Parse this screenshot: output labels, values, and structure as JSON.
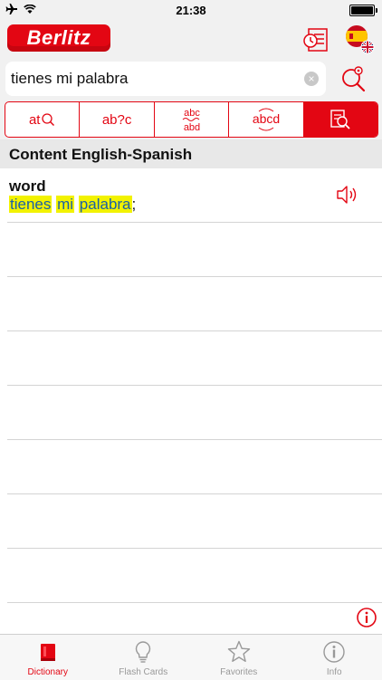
{
  "status": {
    "time": "21:38"
  },
  "header": {
    "logo_text": "Berlitz"
  },
  "search": {
    "value": "tienes mi palabra"
  },
  "modes": [
    {
      "label": "at",
      "icon": "search-word-icon"
    },
    {
      "label": "ab?c",
      "icon": "wildcard-icon"
    },
    {
      "label": "abc/abd",
      "icon": "fuzzy-icon"
    },
    {
      "label": "abcd",
      "icon": "anagram-icon"
    },
    {
      "label": "",
      "icon": "content-search-icon",
      "active": true
    }
  ],
  "section": {
    "title": "Content English-Spanish"
  },
  "results": [
    {
      "word": "word",
      "translation_parts": [
        "tienes",
        " ",
        "mi",
        " ",
        "palabra",
        ";"
      ]
    }
  ],
  "tabs": [
    {
      "label": "Dictionary",
      "icon": "dictionary-icon",
      "active": true
    },
    {
      "label": "Flash Cards",
      "icon": "lightbulb-icon"
    },
    {
      "label": "Favorites",
      "icon": "star-icon"
    },
    {
      "label": "Info",
      "icon": "info-icon"
    }
  ],
  "colors": {
    "accent": "#e30613",
    "highlight": "#f2f200",
    "link": "#1a5fa8"
  }
}
